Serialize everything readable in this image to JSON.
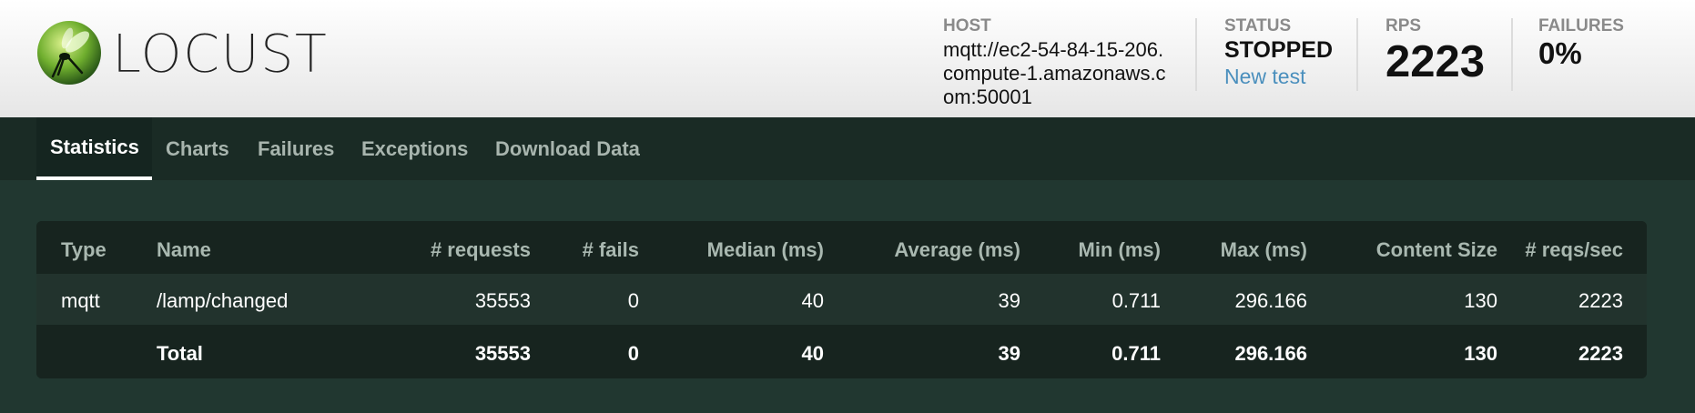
{
  "app": {
    "logo_text": "LOCUST"
  },
  "header": {
    "host_label": "HOST",
    "host_value": "mqtt://ec2-54-84-15-206.compute-1.amazonaws.com:50001",
    "status_label": "STATUS",
    "status_value": "STOPPED",
    "new_test_label": "New test",
    "rps_label": "RPS",
    "rps_value": "2223",
    "failures_label": "FAILURES",
    "failures_value": "0%"
  },
  "tabs": [
    {
      "label": "Statistics",
      "active": true
    },
    {
      "label": "Charts"
    },
    {
      "label": "Failures"
    },
    {
      "label": "Exceptions"
    },
    {
      "label": "Download Data"
    }
  ],
  "table": {
    "columns": [
      "Type",
      "Name",
      "# requests",
      "# fails",
      "Median (ms)",
      "Average (ms)",
      "Min (ms)",
      "Max (ms)",
      "Content Size",
      "# reqs/sec"
    ],
    "rows": [
      [
        "mqtt",
        "/lamp/changed",
        "35553",
        "0",
        "40",
        "39",
        "0.711",
        "296.166",
        "130",
        "2223"
      ]
    ],
    "total": [
      "",
      "Total",
      "35553",
      "0",
      "40",
      "39",
      "0.711",
      "296.166",
      "130",
      "2223"
    ]
  },
  "colors": {
    "background": "#213730",
    "navbar": "#1a2b25",
    "table": "#17241f",
    "link": "#4a8fbd"
  }
}
